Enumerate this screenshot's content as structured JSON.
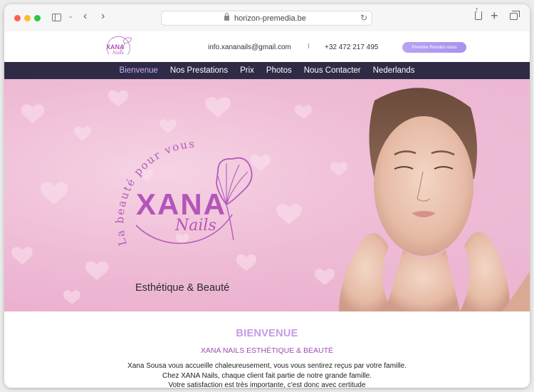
{
  "browser": {
    "url": "horizon-premedia.be"
  },
  "header": {
    "email": "info.xananails@gmail.com",
    "separator": "I",
    "phone": "+32 472 217 495",
    "cta_label": "Prendre Rendez-vous"
  },
  "logo": {
    "arc_text": "La beauté pour vous",
    "brand": "XANA",
    "script": "Nails"
  },
  "nav": {
    "items": [
      {
        "label": "Bienvenue",
        "active": true
      },
      {
        "label": "Nos Prestations",
        "active": false
      },
      {
        "label": "Prix",
        "active": false
      },
      {
        "label": "Photos",
        "active": false
      },
      {
        "label": "Nous Contacter",
        "active": false
      },
      {
        "label": "Nederlands",
        "active": false
      }
    ]
  },
  "hero": {
    "tagline": "Esthétique & Beauté"
  },
  "content": {
    "title": "BIENVENUE",
    "subtitle": "XANA NAILS ESTHÉTIQUE & BEAUTÉ",
    "lines": [
      "Xana Sousa vous accueille chaleureusement, vous vous sentirez reçus par votre famille.",
      "Chez XANA Nails, chaque client fait partie de notre grande famille.",
      "Votre satisfaction est très importante, c'est donc avec certitude"
    ]
  },
  "colors": {
    "nav_bg": "#2f2a45",
    "accent_purple": "#c79ae8",
    "brand_magenta": "#b455b8",
    "cta": "#b9a2f2"
  }
}
